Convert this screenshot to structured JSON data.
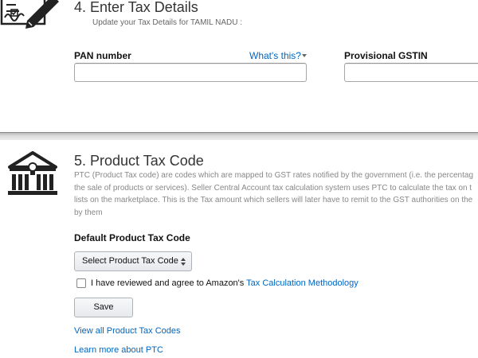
{
  "section4": {
    "title": "4. Enter Tax Details",
    "subtitle": "Update your Tax Details for TAMIL NADU :",
    "pan_label": "PAN number",
    "whats_this": "What's this?",
    "gstin_label": "Provisional GSTIN",
    "pan_value": "",
    "gstin_value": ""
  },
  "section5": {
    "title": "5. Product Tax Code",
    "description_lines": [
      "PTC (Product Tax code) are codes which are mapped to GST rates notified by the government (i.e. the percentag",
      "the sale of products or services). Seller Central Account tax calculation system uses PTC to calculate the tax on t",
      "lists on the marketplace. This is the Tax amount which sellers will later have to remit to the GST authorities on the",
      "by them"
    ],
    "default_label": "Default Product Tax Code",
    "select_label": "Select Product Tax Code",
    "agree_text": "I have reviewed and agree to Amazon's ",
    "agree_link": "Tax Calculation Methodology",
    "agree_checked": false,
    "save_label": "Save",
    "view_all_link": "View all Product Tax Codes",
    "learn_more_link": "Learn more about PTC"
  },
  "icons": {
    "section4_icon": "signed-document-pen-icon",
    "section5_icon": "government-building-icon",
    "select_icon": "updown-arrows-icon",
    "whats_this_icon": "caret-down-icon"
  },
  "colors": {
    "link": "#0066c0",
    "text": "#333333",
    "muted": "#888888"
  }
}
